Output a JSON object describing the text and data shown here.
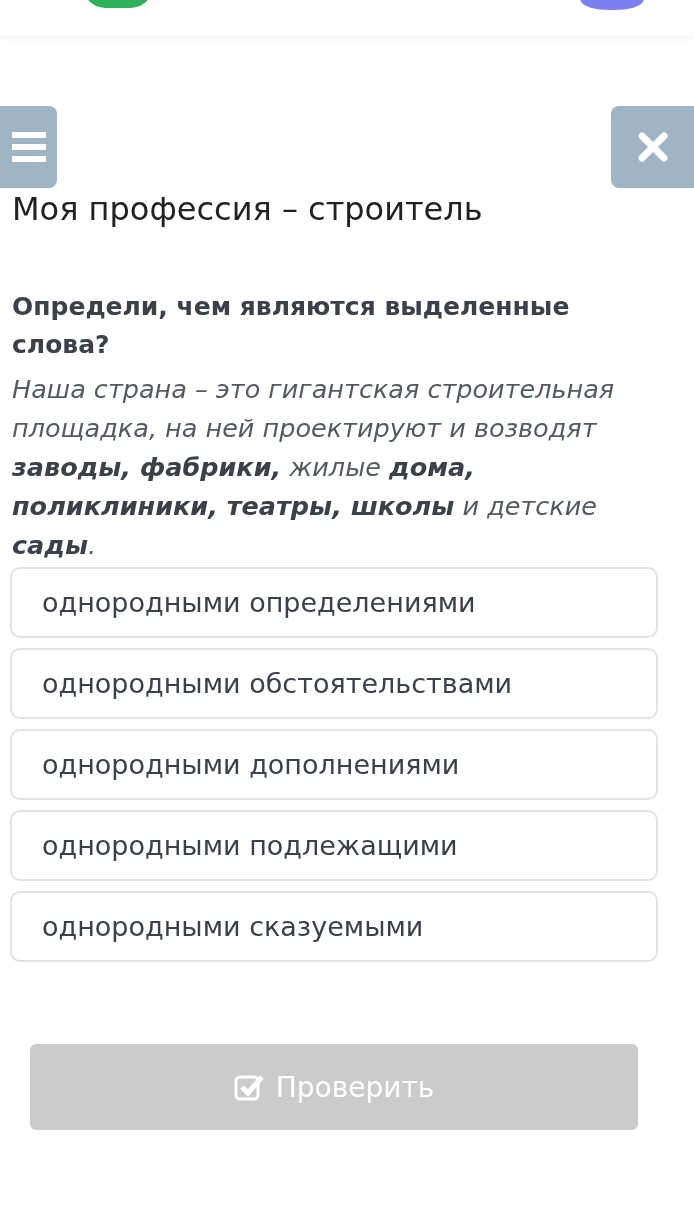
{
  "title": "Моя профессия – строитель",
  "question": "Определи, чем являются выделенные слова?",
  "passage": "Наша страна – это гигантская строительная площадка, на ней проектируют и возводят **заводы, фабрики,** жилые **дома, поликлиники, театры, школы** и детские **сады**.",
  "options": [
    {
      "label": "однородными определениями",
      "selected": false
    },
    {
      "label": "однородными обстоятельствами",
      "selected": false
    },
    {
      "label": "однородными дополнениями",
      "selected": false
    },
    {
      "label": "однородными подлежащими",
      "selected": false
    },
    {
      "label": "однородными сказуемыми",
      "selected": false
    }
  ],
  "check_button": {
    "label": "Проверить",
    "disabled": true
  }
}
